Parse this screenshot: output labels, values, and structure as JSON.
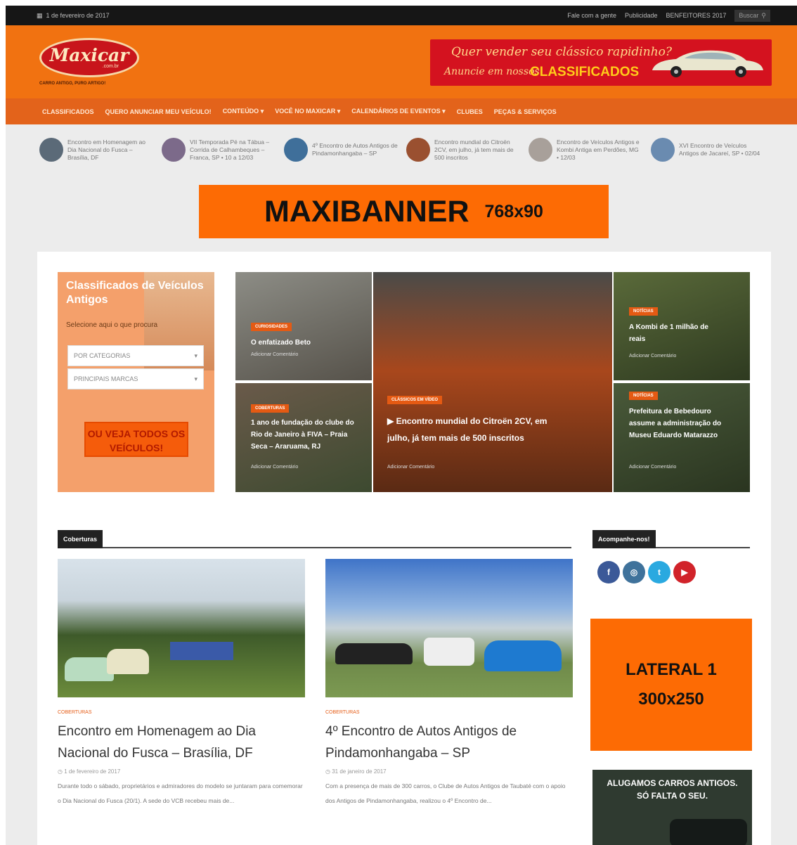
{
  "topbar": {
    "date": "1 de fevereiro de 2017",
    "links": [
      "Fale com a gente",
      "Publicidade",
      "BENFEITORES 2017"
    ],
    "search_label": "Buscar"
  },
  "header": {
    "logo_text": "Maxicar",
    "logo_domain": ".com.br",
    "logo_tagline": "CARRO ANTIGO, PURO ARTIGO!",
    "ad": {
      "line1": "Quer vender seu clássico rapidinho?",
      "line2": "Anuncie em nossos",
      "line3": "CLASSIFICADOS"
    }
  },
  "nav": {
    "items": [
      "CLASSIFICADOS",
      "QUERO ANUNCIAR MEU VEÍCULO!",
      "CONTEÚDO",
      "VOCÊ NO MAXICAR",
      "CALENDÁRIOS DE EVENTOS",
      "CLUBES",
      "PEÇAS & SERVIÇOS"
    ]
  },
  "ticker": [
    {
      "text": "Encontro em Homenagem ao Dia Nacional do Fusca – Brasília, DF",
      "color": "#5b6a78"
    },
    {
      "text": "VII Temporada Pé na Tábua – Corrida de Calhambeques – Franca, SP • 10 a 12/03",
      "color": "#7c6a8a"
    },
    {
      "text": "4º Encontro de Autos Antigos de Pindamonhangaba – SP",
      "color": "#3f6f9a"
    },
    {
      "text": "Encontro mundial do Citroën 2CV, em julho, já tem mais de 500 inscritos",
      "color": "#9a5030"
    },
    {
      "text": "Encontro de Veículos Antigos e Kombi Antiga em Perdões, MG • 12/03",
      "color": "#a8a09a"
    },
    {
      "text": "XVI Encontro de Veículos Antigos de Jacareí, SP • 02/04",
      "color": "#6a8bb0"
    }
  ],
  "maxibanner": {
    "main": "MAXIBANNER",
    "size": "768x90"
  },
  "classifieds": {
    "title": "Classificados de Veículos Antigos",
    "subtitle": "Selecione aqui o que procura",
    "select1": "POR CATEGORIAS",
    "select2": "PRINCIPAIS MARCAS",
    "cta": "OU VEJA TODOS OS VEÍCULOS!"
  },
  "featured": [
    {
      "category": "CURIOSIDADES",
      "title": "O enfatizado Beto",
      "meta": "Adicionar Comentário"
    },
    {
      "category": "COBERTURAS",
      "title": "1 ano de fundação do clube do Rio de Janeiro à FIVA – Praia Seca – Araruama, RJ",
      "meta": "Adicionar Comentário"
    },
    {
      "category": "CLÁSSICOS EM VÍDEO",
      "title": "▶ Encontro mundial do Citroën 2CV, em julho, já tem mais de 500 inscritos",
      "meta": "Adicionar Comentário"
    },
    {
      "category": "NOTÍCIAS",
      "title": "A Kombi de 1 milhão de reais",
      "meta": "Adicionar Comentário"
    },
    {
      "category": "NOTÍCIAS",
      "title": "Prefeitura de Bebedouro assume a administração do Museu Eduardo Matarazzo",
      "meta": "Adicionar Comentário"
    }
  ],
  "sections": {
    "coverage": "Coberturas",
    "follow": "Acompanhe-nos!"
  },
  "articles": [
    {
      "category": "COBERTURAS",
      "title": "Encontro em Homenagem ao Dia Nacional do Fusca – Brasília, DF",
      "date": "1 de fevereiro de 2017",
      "excerpt": "Durante todo o sábado, proprietários e admiradores do modelo se juntaram para comemorar o Dia Nacional do Fusca (20/1). A sede do VCB recebeu mais de..."
    },
    {
      "category": "COBERTURAS",
      "title": "4º Encontro de Autos Antigos de Pindamonhangaba – SP",
      "date": "31 de janeiro de 2017",
      "excerpt": "Com a presença de mais de 300 carros, o Clube de Autos Antigos de Taubaté com o apoio dos Antigos de Pindamonhangaba, realizou o 4º Encontro de..."
    }
  ],
  "social": [
    {
      "name": "facebook-icon",
      "glyph": "f",
      "color": "#3b5998"
    },
    {
      "name": "instagram-icon",
      "glyph": "◎",
      "color": "#3f729b"
    },
    {
      "name": "twitter-icon",
      "glyph": "t",
      "color": "#2aa9e0"
    },
    {
      "name": "youtube-icon",
      "glyph": "▶",
      "color": "#d1232a"
    }
  ],
  "lateral": {
    "line1": "LATERAL 1",
    "line2": "300x250"
  },
  "rental_ad": {
    "line1": "ALUGAMOS CARROS ANTIGOS.",
    "line2": "SÓ FALTA O SEU."
  }
}
